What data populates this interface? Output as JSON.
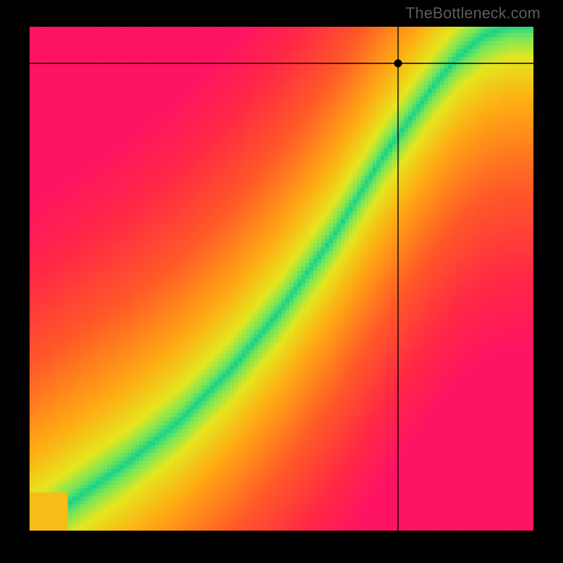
{
  "watermark": "TheBottleneck.com",
  "chart_data": {
    "type": "heatmap",
    "title": "",
    "xlabel": "",
    "ylabel": "",
    "xlim": [
      0,
      100
    ],
    "ylim": [
      0,
      100
    ],
    "grid": false,
    "legend": false,
    "colormap_description": "diverging: red -> orange -> yellow -> green -> yellow -> orange -> red along distance from optimal curve",
    "optimal_curve": {
      "description": "Green band center y(x); roughly y = 7 + 0.11*x^1.78 with curvature; band width ~6% of axis; outside band falls off to yellow then orange then red",
      "samples_x": [
        0,
        10,
        20,
        30,
        40,
        50,
        60,
        70,
        80,
        85,
        90,
        95,
        100
      ],
      "samples_y": [
        0,
        7,
        14,
        22,
        32,
        44,
        58,
        74,
        88,
        94,
        98,
        100,
        100
      ]
    },
    "crosshair": {
      "x": 73,
      "y": 92.5,
      "marker_radius_pct": 0.8
    },
    "pixel_grid": 128
  }
}
